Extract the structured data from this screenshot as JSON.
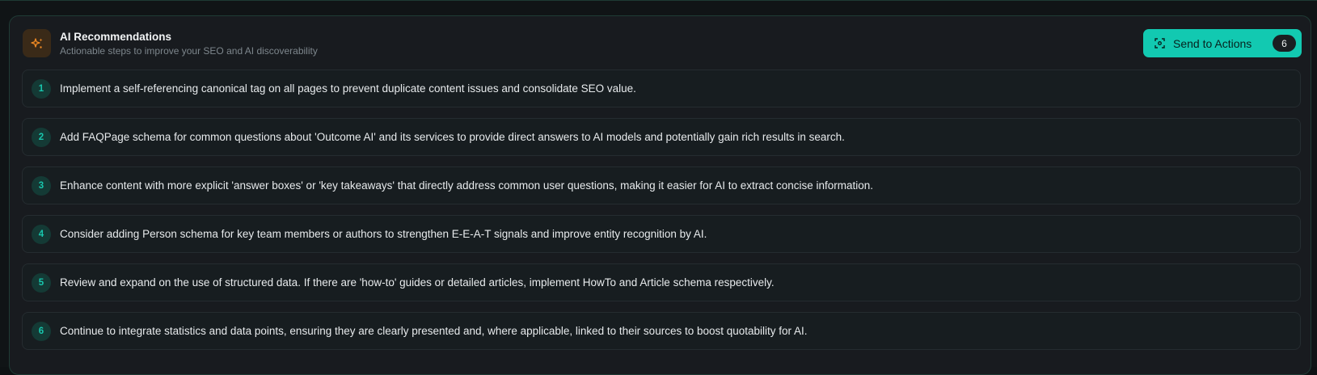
{
  "header": {
    "title": "AI Recommendations",
    "subtitle": "Actionable steps to improve your SEO and AI discoverability",
    "icon": "sparkles-icon",
    "icon_color": "#f08a24"
  },
  "send_button": {
    "label": "Send to Actions",
    "count": "6",
    "icon": "scan-icon",
    "color": "#12c9b1"
  },
  "recommendations": [
    {
      "number": "1",
      "text": "Implement a self-referencing canonical tag on all pages to prevent duplicate content issues and consolidate SEO value."
    },
    {
      "number": "2",
      "text": "Add FAQPage schema for common questions about 'Outcome AI' and its services to provide direct answers to AI models and potentially gain rich results in search."
    },
    {
      "number": "3",
      "text": "Enhance content with more explicit 'answer boxes' or 'key takeaways' that directly address common user questions, making it easier for AI to extract concise information."
    },
    {
      "number": "4",
      "text": "Consider adding Person schema for key team members or authors to strengthen E-E-A-T signals and improve entity recognition by AI."
    },
    {
      "number": "5",
      "text": "Review and expand on the use of structured data. If there are 'how-to' guides or detailed articles, implement HowTo and Article schema respectively."
    },
    {
      "number": "6",
      "text": "Continue to integrate statistics and data points, ensuring they are clearly presented and, where applicable, linked to their sources to boost quotability for AI."
    }
  ]
}
